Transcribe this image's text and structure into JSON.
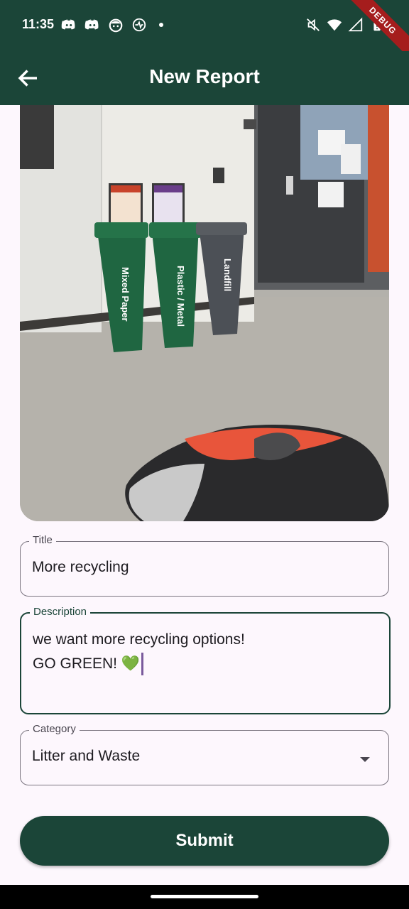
{
  "status_bar": {
    "time": "11:35",
    "debug_label": "DEBUG",
    "notification_icons": [
      "discord-icon",
      "discord-icon",
      "app-face-icon",
      "sync-icon",
      "dot-icon"
    ],
    "system_icons": [
      "mute-icon",
      "wifi-icon",
      "signal-icon",
      "battery-icon"
    ]
  },
  "app_bar": {
    "title": "New Report",
    "back_icon": "arrow-back-icon"
  },
  "photo": {
    "bin_labels": [
      "Mixed Paper",
      "Plastic / Metal",
      "Landfill"
    ]
  },
  "form": {
    "title": {
      "label": "Title",
      "value": "More recycling"
    },
    "description": {
      "label": "Description",
      "line1": "we want more recycling options!",
      "line2": "GO GREEN! 💚"
    },
    "category": {
      "label": "Category",
      "value": "Litter and Waste",
      "icon": "dropdown-arrow-icon"
    },
    "submit_label": "Submit"
  },
  "colors": {
    "primary": "#1b4538",
    "background": "#fdf7fd",
    "outline": "#7b7580",
    "debug_ribbon": "#a51d1d"
  }
}
